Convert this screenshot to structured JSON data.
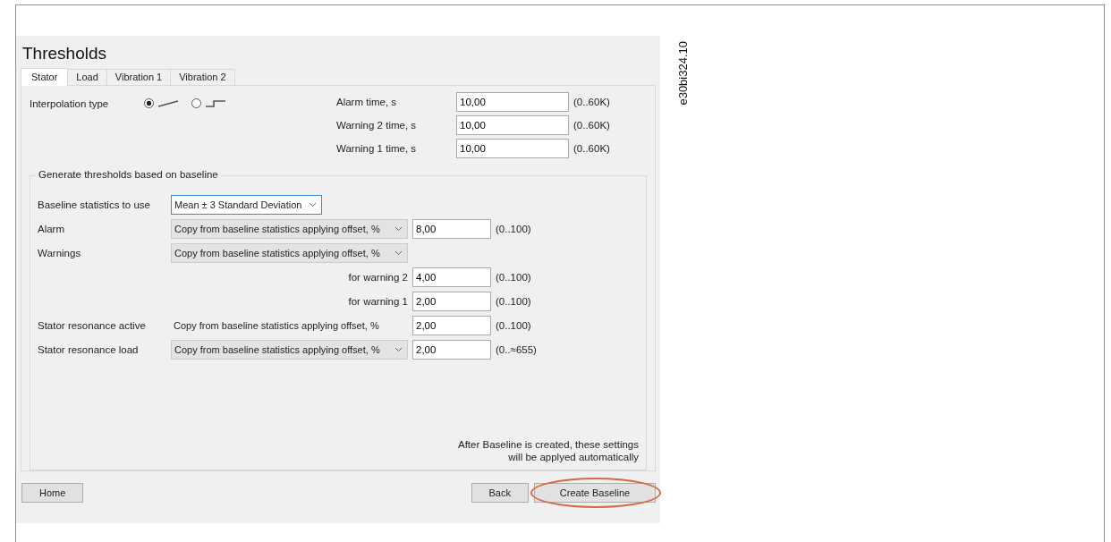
{
  "title": "Thresholds",
  "tabs": [
    {
      "label": "Stator",
      "selected": true
    },
    {
      "label": "Load",
      "selected": false
    },
    {
      "label": "Vibration 1",
      "selected": false
    },
    {
      "label": "Vibration 2",
      "selected": false
    }
  ],
  "interpolation": {
    "label": "Interpolation type",
    "options": [
      {
        "kind": "linear",
        "selected": true
      },
      {
        "kind": "step",
        "selected": false
      }
    ]
  },
  "times": [
    {
      "label": "Alarm time, s",
      "value": "10,00",
      "range": "(0..60K)"
    },
    {
      "label": "Warning 2 time, s",
      "value": "10,00",
      "range": "(0..60K)"
    },
    {
      "label": "Warning 1 time, s",
      "value": "10,00",
      "range": "(0..60K)"
    }
  ],
  "baseline_group": {
    "title": "Generate thresholds based on baseline",
    "rows": [
      {
        "kind": "combo",
        "label": "Baseline statistics to use",
        "dropdown": "Mean ± 3 Standard Deviation",
        "focused": true
      },
      {
        "kind": "combo",
        "label": "Alarm",
        "dropdown": "Copy from baseline statistics applying offset, %",
        "focused": false,
        "value": "8,00",
        "range": "(0..100)"
      },
      {
        "kind": "combo",
        "label": "Warnings",
        "dropdown": "Copy from baseline statistics applying offset, %",
        "focused": false
      },
      {
        "kind": "sub",
        "label": "for warning 2",
        "value": "4,00",
        "range": "(0..100)"
      },
      {
        "kind": "sub",
        "label": "for warning 1",
        "value": "2,00",
        "range": "(0..100)"
      },
      {
        "kind": "text",
        "label": "Stator resonance active",
        "text": "Copy from baseline statistics applying offset, %",
        "value": "2,00",
        "range": "(0..100)"
      },
      {
        "kind": "combo",
        "label": "Stator resonance load",
        "dropdown": "Copy from baseline statistics applying offset, %",
        "focused": false,
        "value": "2,00",
        "range": "(0..≈655)"
      }
    ],
    "note": "After Baseline is created, these settings will be applyed automatically"
  },
  "buttons": [
    {
      "label": "Home",
      "highlighted": false
    },
    {
      "label": "Back",
      "highlighted": false
    },
    {
      "label": "Create Baseline",
      "highlighted": true
    }
  ],
  "figure_id": "e30bi324.10"
}
